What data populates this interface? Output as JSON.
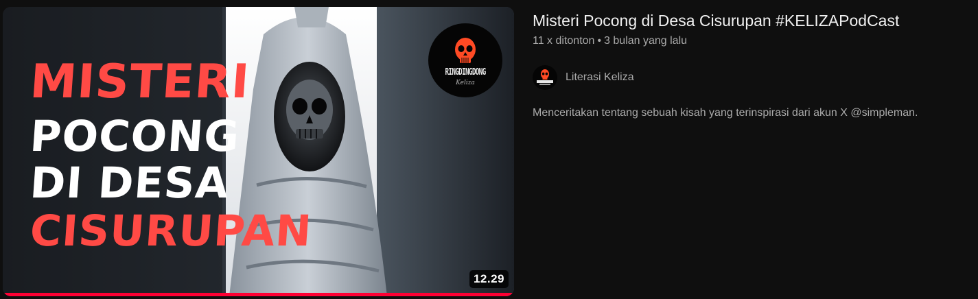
{
  "video": {
    "title": "Misteri Pocong di Desa Cisurupan #KELIZAPodCast",
    "views": "11 x ditonton",
    "separator": "•",
    "published": "3 bulan yang lalu",
    "duration": "12.29",
    "watch_progress": 1.0,
    "description": "Menceritakan tentang sebuah kisah yang terinspirasi dari akun X @simpleman."
  },
  "thumbnail": {
    "lines": [
      "MISTERI",
      "POCONG",
      "DI DESA",
      "CISURUPAN"
    ],
    "line_colors": [
      "#ff4a45",
      "#ffffff",
      "#ffffff",
      "#ff4a45"
    ],
    "badge_word": "RINGDINGDONG",
    "badge_sub": "Keliza"
  },
  "channel": {
    "name": "Literasi Keliza",
    "avatar_icon": "skull-logo-icon"
  },
  "colors": {
    "background": "#0f0f0f",
    "accent": "#ff0033",
    "secondary_text": "#aaaaaa"
  }
}
